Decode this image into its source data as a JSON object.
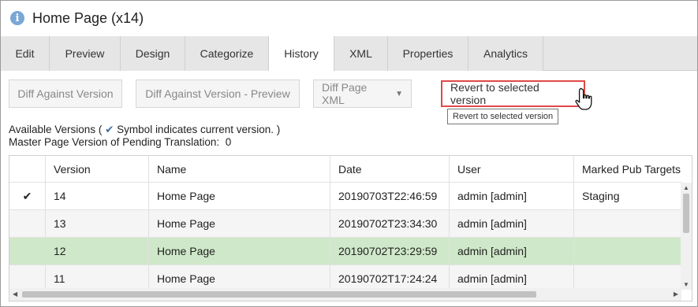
{
  "window": {
    "title": "Home Page (x14)",
    "info_icon": "info-icon"
  },
  "tabs": [
    {
      "label": "Edit"
    },
    {
      "label": "Preview"
    },
    {
      "label": "Design"
    },
    {
      "label": "Categorize"
    },
    {
      "label": "History",
      "active": true
    },
    {
      "label": "XML"
    },
    {
      "label": "Properties"
    },
    {
      "label": "Analytics"
    }
  ],
  "toolbar": {
    "diff_version": "Diff Against Version",
    "diff_preview": "Diff Against Version - Preview",
    "diff_xml": "Diff Page XML",
    "revert": "Revert to selected version",
    "tooltip": "Revert to selected version"
  },
  "info": {
    "available_prefix": "Available Versions (",
    "available_suffix": "Symbol indicates current version. )",
    "master_label": "Master Page Version of Pending Translation:",
    "master_value": "0"
  },
  "table": {
    "columns": [
      "",
      "Version",
      "Name",
      "Date",
      "User",
      "Marked Pub Targets"
    ],
    "rows": [
      {
        "current": "✔",
        "version": "14",
        "name": "Home Page",
        "date": "20190703T22:46:59",
        "user": "admin [admin]",
        "targets": "Staging"
      },
      {
        "current": "",
        "version": "13",
        "name": "Home Page",
        "date": "20190702T23:34:30",
        "user": "admin [admin]",
        "targets": ""
      },
      {
        "current": "",
        "version": "12",
        "name": "Home Page",
        "date": "20190702T23:29:59",
        "user": "admin [admin]",
        "targets": ""
      },
      {
        "current": "",
        "version": "11",
        "name": "Home Page",
        "date": "20190702T17:24:24",
        "user": "admin [admin]",
        "targets": ""
      }
    ],
    "selected_row": 2
  },
  "colors": {
    "accent_red": "#e04848",
    "selected_row": "#cfe8c9",
    "check": "#3f6fa3"
  }
}
